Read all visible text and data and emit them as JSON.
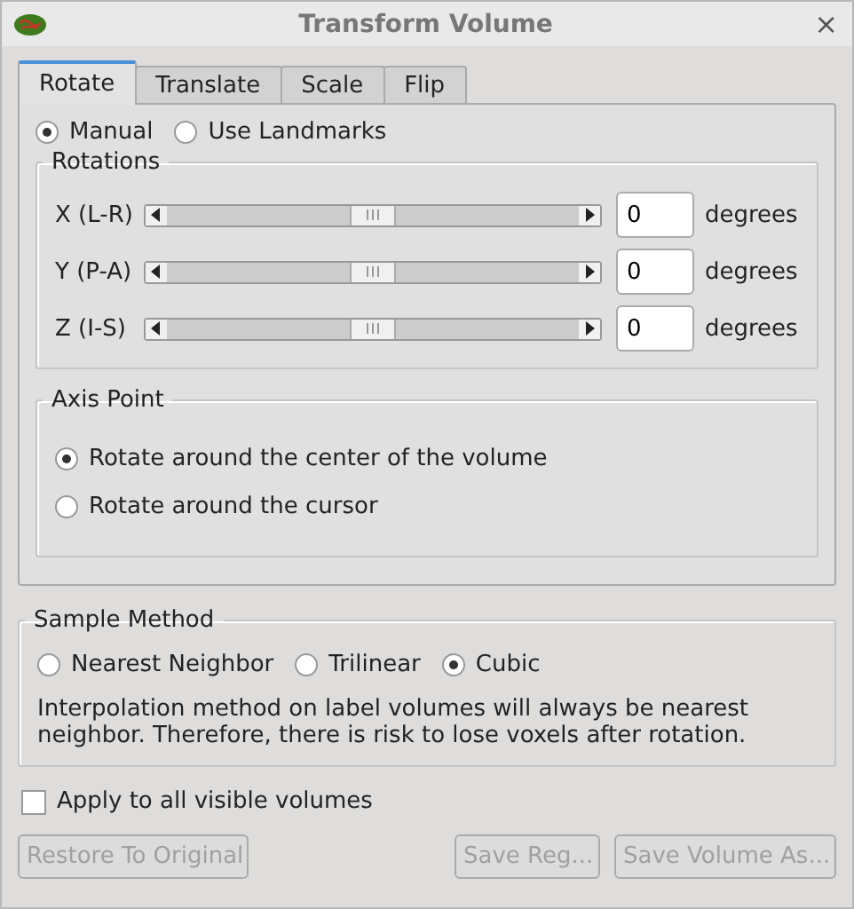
{
  "window": {
    "title": "Transform Volume",
    "close": "×"
  },
  "tabs": [
    {
      "label": "Rotate",
      "selected": true
    },
    {
      "label": "Translate",
      "selected": false
    },
    {
      "label": "Scale",
      "selected": false
    },
    {
      "label": "Flip",
      "selected": false
    }
  ],
  "mode": [
    {
      "label": "Manual",
      "selected": true
    },
    {
      "label": "Use Landmarks",
      "selected": false
    }
  ],
  "rotations": {
    "title": "Rotations",
    "rows": [
      {
        "label": "X (L-R)",
        "level": 0.5,
        "value": "0",
        "unit": "degrees"
      },
      {
        "label": "Y (P-A)",
        "level": 0.5,
        "value": "0",
        "unit": "degrees"
      },
      {
        "label": "Z (I-S)",
        "level": 0.5,
        "value": "0",
        "unit": "degrees"
      }
    ]
  },
  "axis_point": {
    "title": "Axis Point",
    "options": [
      {
        "label": "Rotate around the center of the volume",
        "selected": true
      },
      {
        "label": "Rotate around the cursor",
        "selected": false
      }
    ]
  },
  "sample_method": {
    "title": "Sample Method",
    "options": [
      {
        "label": "Nearest Neighbor",
        "selected": false
      },
      {
        "label": "Trilinear",
        "selected": false
      },
      {
        "label": "Cubic",
        "selected": true
      }
    ],
    "note": "Interpolation method on label volumes will always be nearest neighbor. Therefore, there is risk to lose voxels after rotation."
  },
  "apply_all": {
    "label": "Apply to all visible volumes",
    "checked": false
  },
  "buttons": [
    {
      "label": "Restore To Original",
      "disabled": true
    },
    {
      "label": "Save Reg...",
      "disabled": true
    },
    {
      "label": "Save Volume As...",
      "disabled": true
    }
  ]
}
